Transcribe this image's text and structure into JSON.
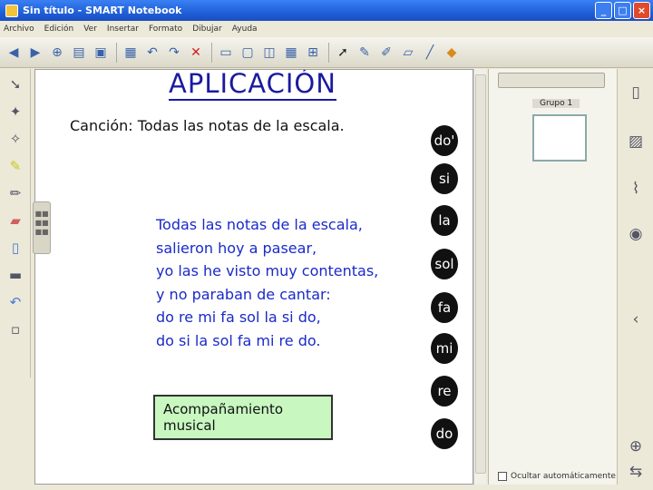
{
  "window": {
    "title": "Sin título - SMART Notebook",
    "minimize": "_",
    "maximize": "□",
    "close": "×"
  },
  "menu": [
    "Archivo",
    "Edición",
    "Ver",
    "Insertar",
    "Formato",
    "Dibujar",
    "Ayuda"
  ],
  "toolbar_icons": [
    "back-icon",
    "forward-icon",
    "add-page-icon",
    "open-icon",
    "save-icon",
    "paste-icon",
    "undo-icon",
    "redo-icon",
    "delete-icon",
    "screen-shade-icon",
    "display-icon",
    "table-icon",
    "select-icon",
    "pen-icon",
    "eraser-icon",
    "line-icon",
    "shape-icon"
  ],
  "page": {
    "title": "APLICACIÓN",
    "song_title": "Canción: Todas las notas de la escala.",
    "lyrics": [
      "Todas las notas de la escala,",
      "salieron hoy a pasear,",
      "yo las he visto muy contentas,",
      "y no paraban de cantar:",
      "do re mi fa sol la si do,",
      "do si la sol fa mi re do."
    ],
    "button_label": "Acompañamiento musical",
    "page_link": "",
    "notes": [
      "do'",
      "si",
      "la",
      "sol",
      "fa",
      "mi",
      "re",
      "do"
    ]
  },
  "side_panel": {
    "group_button": "",
    "group_label": "Grupo 1",
    "thumb_caption": "",
    "auto_hide_label": "Ocultar automáticamente"
  },
  "colors": {
    "title": "#1a1aa0",
    "lyrics": "#1a2ac8",
    "button_bg": "#c8f7c0",
    "note_bg": "#111111"
  }
}
